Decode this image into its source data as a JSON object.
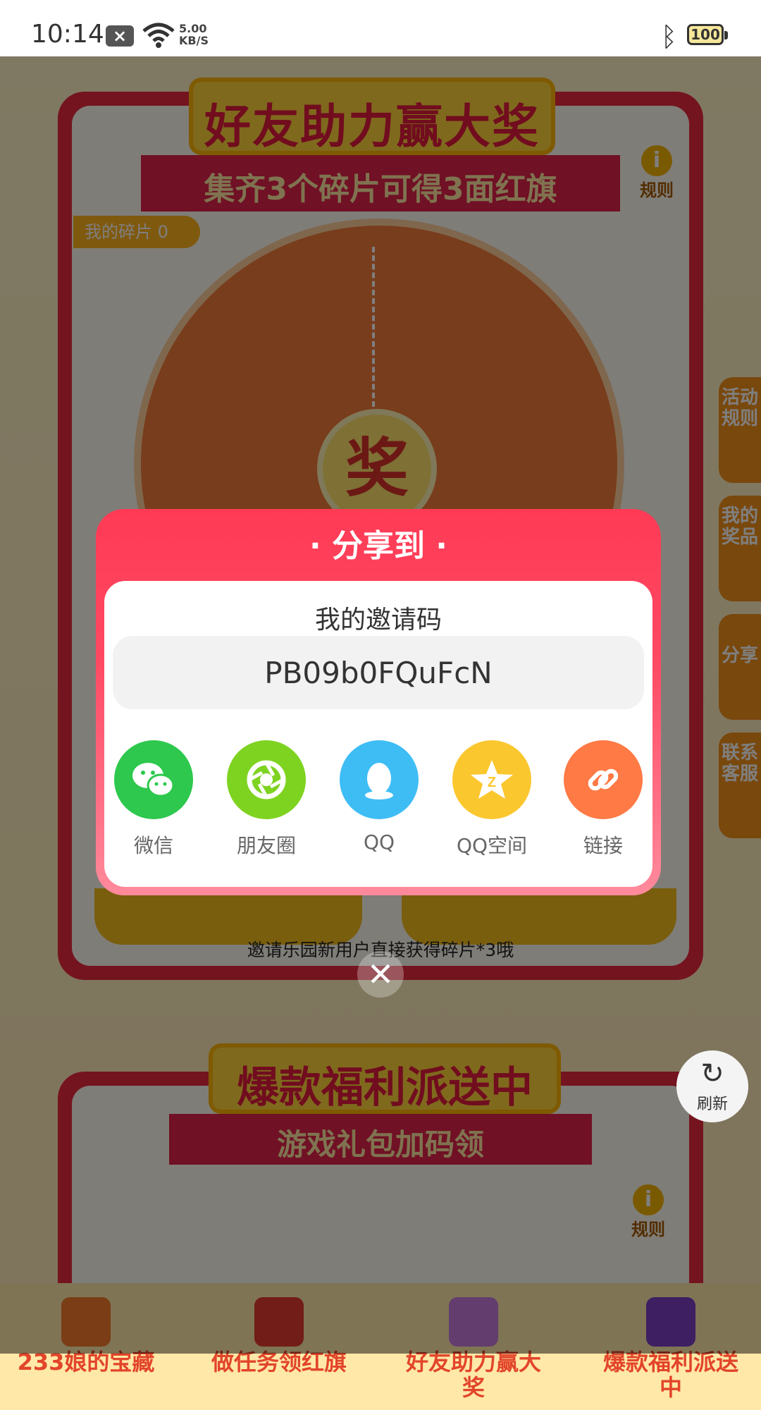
{
  "status_bar": {
    "time": "10:14",
    "speed_value": "5.00",
    "speed_unit": "KB/S",
    "battery": "100"
  },
  "background": {
    "banner_title": "好友助力赢大奖",
    "subtitle": "集齐3个碎片可得3面红旗",
    "rules_label": "规则",
    "my_pieces": "我的碎片 0",
    "wheel_center": "奖",
    "hint": "邀请乐园新用户直接获得碎片*3哦",
    "side_tabs": [
      "活动规则",
      "我的奖品",
      "分享",
      "联系客服"
    ],
    "section2_title": "爆款福利派送中",
    "section2_subtitle": "游戏礼包加码领",
    "section2_rules": "规则",
    "refresh_label": "刷新"
  },
  "bottom_nav": [
    {
      "label": "233娘的宝藏"
    },
    {
      "label": "做任务领红旗"
    },
    {
      "label": "好友助力赢大奖"
    },
    {
      "label": "爆款福利派送中"
    }
  ],
  "share_modal": {
    "title": "· 分享到 ·",
    "invite_label": "我的邀请码",
    "invite_code": "PB09b0FQuFcN",
    "targets": [
      {
        "label": "微信",
        "icon": "wechat-icon",
        "color": "#2dc84d"
      },
      {
        "label": "朋友圈",
        "icon": "moments-icon",
        "color": "#7ed321"
      },
      {
        "label": "QQ",
        "icon": "qq-icon",
        "color": "#3ebdf5"
      },
      {
        "label": "QQ空间",
        "icon": "qzone-icon",
        "color": "#fbc72f"
      },
      {
        "label": "链接",
        "icon": "link-icon",
        "color": "#ff7a45"
      }
    ],
    "close_icon": "close-icon"
  },
  "colors": {
    "modal_header": "#ff3a55",
    "accent_red": "#e8283f",
    "accent_yellow": "#ffd23a"
  }
}
